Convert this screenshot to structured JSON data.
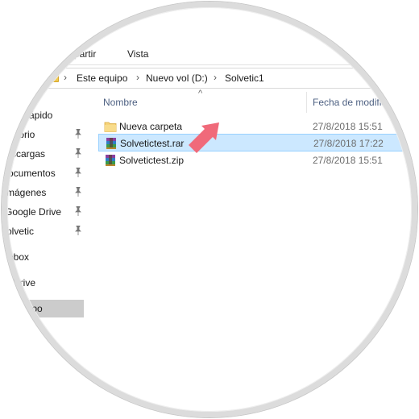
{
  "ribbon": {
    "tabs": [
      "Compartir",
      "Vista"
    ],
    "visible_tabs": [
      "mpartir",
      "Vista"
    ]
  },
  "address": {
    "crumbs": [
      "Este equipo",
      "Nuevo vol (D:)",
      "Solvetic1"
    ]
  },
  "nav": {
    "items": [
      {
        "label": "rápido",
        "pinned": false
      },
      {
        "label": "torio",
        "pinned": true
      },
      {
        "label": "scargas",
        "pinned": true
      },
      {
        "label": "ocumentos",
        "pinned": true
      },
      {
        "label": "mágenes",
        "pinned": true
      },
      {
        "label": "Google Drive",
        "pinned": true
      },
      {
        "label": "olvetic",
        "pinned": true
      },
      {
        "label": "pbox",
        "pinned": false
      },
      {
        "label": "Drive",
        "pinned": false
      },
      {
        "label": "uipo",
        "pinned": false,
        "selected": true
      }
    ]
  },
  "columns": {
    "name": "Nombre",
    "date": "Fecha de modific"
  },
  "files": [
    {
      "name": "Nueva carpeta",
      "date": "27/8/2018 15:51",
      "icon": "folder-icon",
      "selected": false
    },
    {
      "name": "Solvetictest.rar",
      "date": "27/8/2018 17:22",
      "icon": "winrar-archive-icon",
      "selected": true
    },
    {
      "name": "Solvetictest.zip",
      "date": "27/8/2018 15:51",
      "icon": "winrar-archive-icon",
      "selected": false
    }
  ],
  "colors": {
    "selection_bg": "#cce8ff",
    "selection_border": "#99d1ff",
    "nav_selected": "#cccccc",
    "arrow": "#f06a7a",
    "header_text": "#4d6082"
  }
}
